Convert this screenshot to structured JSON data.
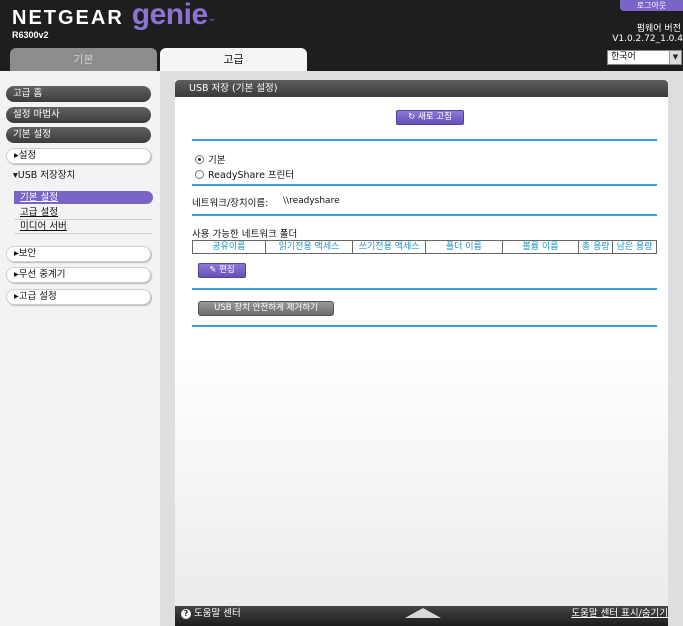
{
  "header": {
    "brand": "NETGEAR",
    "product": "genie",
    "trademark": "™",
    "model": "R6300v2",
    "logout_label": "로그아웃",
    "firmware_label": "펌웨어 버전",
    "firmware_value": "V1.0.2.72_1.0.4",
    "language": "한국어",
    "tabs": [
      {
        "label": "기본",
        "active": false
      },
      {
        "label": "고급",
        "active": true
      }
    ]
  },
  "sidebar": {
    "items": [
      {
        "label": "고급 홈"
      },
      {
        "label": "설정 마법사"
      },
      {
        "label": "기본 설정"
      },
      {
        "label": "▸설정"
      },
      {
        "label": "▾USB 저장장치"
      },
      {
        "label": "▸보안"
      },
      {
        "label": "▸무선 중계기"
      },
      {
        "label": "▸고급 설정"
      }
    ],
    "usb_sub": [
      {
        "label": "기본 설정",
        "active": true
      },
      {
        "label": "고급 설정"
      },
      {
        "label": "미디어 서버"
      }
    ]
  },
  "panel": {
    "title": "USB 저장 (기본 설정)",
    "refresh_label": "새로 고침",
    "refresh_icon": "refresh-icon",
    "mode_options": [
      {
        "label": "기본",
        "selected": true
      },
      {
        "label": "ReadyShare 프린터",
        "selected": false
      }
    ],
    "network_device_label": "네트워크/장치이름:",
    "network_device_value": "\\\\readyshare",
    "folders_title": "사용 가능한 네트워크 폴더",
    "table_headers": [
      "공유이름",
      "읽기전용 액세스",
      "쓰기전용 액세스",
      "폴더 이름",
      "볼륨 이름",
      "총 용량",
      "남은 용량"
    ],
    "edit_label": "편집",
    "edit_icon": "pencil-icon",
    "remove_label": "USB 장치 안전하게 제거하기"
  },
  "footer": {
    "help_label": "도움말 센터",
    "help_toggle": "도움말 센터 표시/숨기기",
    "help_icon": "question-icon"
  },
  "colors": {
    "accent": "#7b64c8",
    "divider": "#3aa1d6",
    "header_bg": "#1e1e1e"
  }
}
